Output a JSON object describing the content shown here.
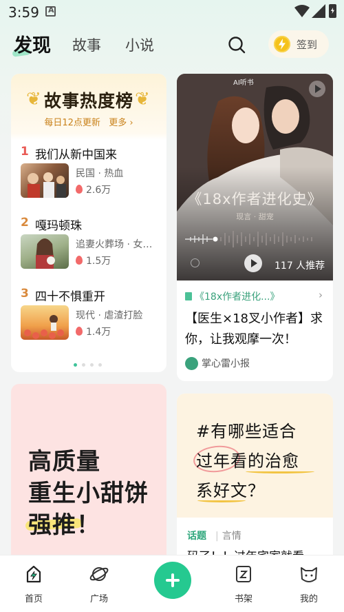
{
  "status_bar": {
    "time": "3:59"
  },
  "header": {
    "tabs": [
      {
        "label": "发现",
        "active": true
      },
      {
        "label": "故事",
        "active": false
      },
      {
        "label": "小说",
        "active": false
      }
    ],
    "checkin_label": "签到"
  },
  "ranking": {
    "title": "故事热度榜",
    "subtitle": "每日12点更新",
    "more": "更多 ›",
    "items": [
      {
        "rank": "1",
        "name": "我们从新中国来",
        "tags": "民国 · 热血",
        "heat": "2.6万"
      },
      {
        "rank": "2",
        "name": "嘎玛顿珠",
        "tags": "追妻火葬场 · 女…",
        "heat": "1.5万"
      },
      {
        "rank": "3",
        "name": "四十不惧重开",
        "tags": "现代 · 虐渣打脸",
        "heat": "1.4万"
      }
    ],
    "page_count": 4,
    "active_page": 1
  },
  "audio_book": {
    "badge": "AI听书",
    "cover_title": "《18x作者进化史》",
    "genre": "现言 · 甜宠",
    "recommend": "117 人推荐",
    "source": "《18x作者进化...》",
    "description": "【医生×18叉小作者】求你，让我观摩一次！",
    "author": "掌心雷小报"
  },
  "promo": {
    "line1": "高质量",
    "line2": "重生小甜饼",
    "line3": "强推！"
  },
  "topic": {
    "line1": "#有哪些适合",
    "line2": "过年看的治愈",
    "line3": "系好文？",
    "tag": "话题",
    "category": "言情",
    "preview": "码了！！过年宅家就看"
  },
  "tabbar": {
    "items": [
      {
        "label": "首页",
        "icon": "home-bolt-icon"
      },
      {
        "label": "广场",
        "icon": "planet-icon"
      },
      {
        "label": "书架",
        "icon": "bookshelf-icon"
      },
      {
        "label": "我的",
        "icon": "cat-face-icon"
      }
    ]
  },
  "colors": {
    "accent": "#25c990",
    "rank_red": "#e95a55",
    "rank_orange": "#d98a3d"
  }
}
